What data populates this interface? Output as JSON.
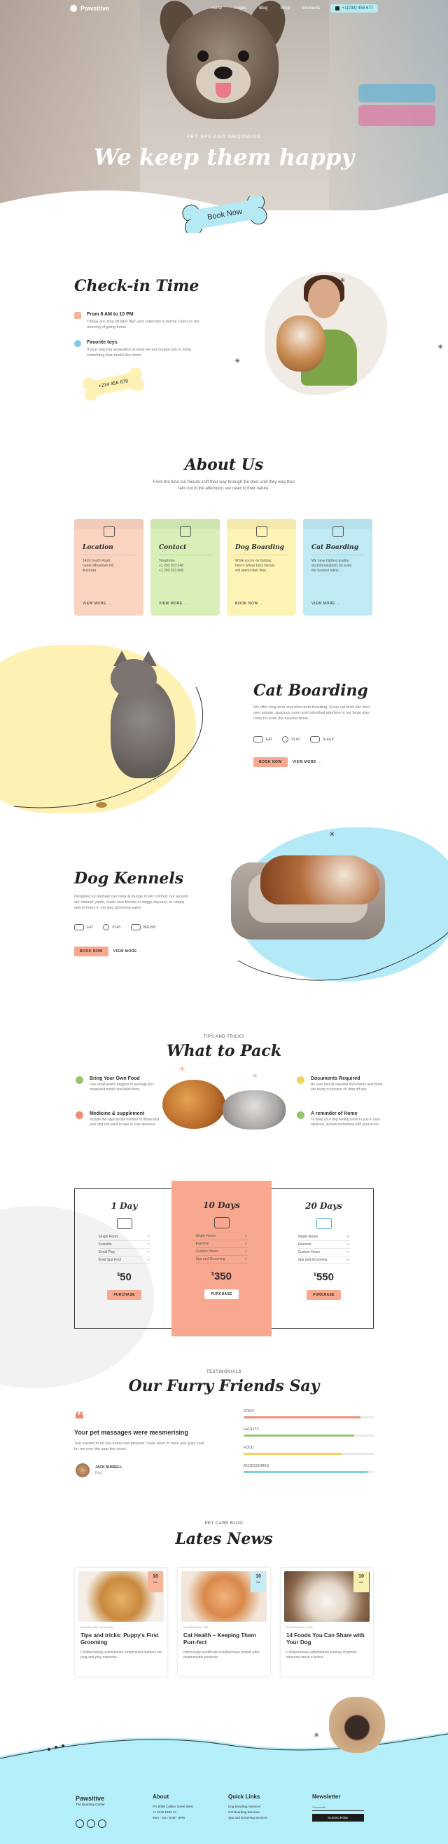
{
  "nav": {
    "brand": "Pawsitive",
    "links": [
      "Home",
      "Pages",
      "Blog",
      "Shop",
      "Elements"
    ],
    "phone": "+1(234) 456 677"
  },
  "hero": {
    "kicker": "PET SPA AND GROOMING",
    "title": "We keep them happy",
    "cta": "Book Now"
  },
  "checkin": {
    "title": "Check-in Time",
    "items": [
      {
        "head": "From 8 AM to 10 PM",
        "text": "Things are drop off after 8am and collection is before 10am on the morning of going home"
      },
      {
        "head": "Favorite toys",
        "text": "If your dog has separation anxiety we encourage you to bring something that smells like home"
      }
    ],
    "phone": "+234 456 678"
  },
  "about": {
    "title": "About Us",
    "subtitle": "From the time our friends sniff their way through the door until they wag their tails out in the afternoon, we cater to their nature.",
    "cards": [
      {
        "head": "Location",
        "lines": [
          "1426 South Road,",
          "Green Meadows NC",
          "Australia"
        ],
        "more": "VIEW MORE →",
        "color": "#fbd3c1"
      },
      {
        "head": "Contact",
        "lines": [
          "Telephone",
          "+1 203 013 548",
          "+1 203 013 608"
        ],
        "more": "VIEW MORE →",
        "color": "#d8efb8"
      },
      {
        "head": "Dog Boarding",
        "lines": [
          "While you're on holiday,",
          "here's where furry friends",
          "will spend their time."
        ],
        "more": "BOOK NOW →",
        "color": "#fdf3b5"
      },
      {
        "head": "Cat Boarding",
        "lines": [
          "We have highest quality",
          "accommodations for even",
          "the fussiest feline."
        ],
        "more": "VIEW MORE →",
        "color": "#bfeaf4"
      }
    ]
  },
  "cat": {
    "title": "Cat Boarding",
    "text": "We offer long-term and short term boarding. Every cat feels like their own private, spacious room and individual attention in our large play room for even the fussiest feline.",
    "feats": [
      "EAT",
      "PLAY",
      "SLEEP"
    ],
    "book": "BOOK NOW",
    "more": "VIEW MORE →"
  },
  "kennels": {
    "title": "Dog Kennels",
    "text": "Designed so animals can relax & lounge in pet comfort, our around our exterior yards, make new friends in doggy daycare, or simply spend hours in our dog grooming salon.",
    "feats": [
      "EAT",
      "PLAY",
      "BRUSH"
    ],
    "book": "BOOK NOW",
    "more": "VIEW MORE →"
  },
  "pack": {
    "kicker": "TIPS AND TRICKS",
    "title": "What to Pack",
    "items": [
      {
        "head": "Bring Your Own Food",
        "text": "Use small plastic baggies to package pre-measured meals and label them.",
        "color": "#93c66e"
      },
      {
        "head": "Medicine & supplement",
        "text": "Include the appropriate number of doses that your dog will need to take in your absence.",
        "color": "#f08b74"
      },
      {
        "head": "Documents Required",
        "text": "Be sure that all required documents and forms are ready to present on drop off day.",
        "color": "#f3d35a"
      },
      {
        "head": "A reminder of Home",
        "text": "To keep your dog feeling close to you in your absence, include something with your scent.",
        "color": "#93c66e"
      }
    ]
  },
  "pricing": {
    "plans": [
      {
        "title": "1 Day",
        "rows": [
          "Single Room",
          "Sociable",
          "Small Play",
          "Bowl Spa Pool"
        ],
        "price": "50",
        "btn": "PURCHASE"
      },
      {
        "title": "10 Days",
        "rows": [
          "Single Room",
          "Exercise",
          "Custom Hours",
          "Spa and Grooming"
        ],
        "price": "350",
        "btn": "PURCHASE"
      },
      {
        "title": "20 Days",
        "rows": [
          "Single Room",
          "Exercise",
          "Custom Hours",
          "Spa and Grooming"
        ],
        "price": "550",
        "btn": "PURCHASE"
      }
    ],
    "currency": "$"
  },
  "testimonials": {
    "kicker": "TESTIMONIALS",
    "title": "Our Furry Friends Say",
    "quote_head": "Your pet massages were mesmerising",
    "quote_text": "Just wanted to let you know how pleased I have been to have you guys care for me over the past few years.",
    "name": "JACK RUSSELL",
    "role": "Dog",
    "bars": [
      {
        "label": "STAFF",
        "value": 0.9,
        "color": "#f08b74"
      },
      {
        "label": "FACILITY",
        "value": 0.85,
        "color": "#93c66e"
      },
      {
        "label": "FOOD",
        "value": 0.75,
        "color": "#f3d35a"
      },
      {
        "label": "ACCESSORIES",
        "value": 0.95,
        "color": "#7fcde3"
      }
    ]
  },
  "news": {
    "kicker": "PET CARE BLOG",
    "title": "Lates News",
    "posts": [
      {
        "day": "10",
        "month": "JUL",
        "meta": "by AxiThemes  |  Grooming",
        "title": "Tips and tricks: Puppy's First Grooming",
        "text": "Collaboratively administrate empowered markets via plug-and-play networks...",
        "color": "#f6b59a"
      },
      {
        "day": "10",
        "month": "JUL",
        "meta": "by AxiThemes  |  Tips",
        "title": "Cat Health – Keeping Them Purr-fect",
        "text": "Intrinsically pontificate installed base portals after maintainable products...",
        "color": "#c6ecf6"
      },
      {
        "day": "10",
        "month": "JUL",
        "meta": "by AxiThemes  |  Food",
        "title": "14 Foods You Can Share with Your Dog",
        "text": "Collaboratively administrate turnkey channels whereas virtual e-tailers...",
        "color": "#f8f0b0"
      }
    ]
  },
  "footer": {
    "brand": "Pawsitive",
    "tagline": "The Boarding Center",
    "about_head": "About",
    "about_lines": [
      "PO 8008 Caliber Street West",
      "+1 2345 5482 47",
      "Mon - Sun: 8AM - 8PM"
    ],
    "links_head": "Quick Links",
    "links": [
      "Dog Boarding Services",
      "Cat Boarding Services",
      "Spa and Grooming Services"
    ],
    "newsletter_head": "Newsletter",
    "email_placeholder": "Your email",
    "subscribe": "SUBSCRIBE"
  },
  "colors": {
    "accent": "#f7a88e",
    "hero_button": "#b5eaf5",
    "footer_bg": "#b4eef9"
  }
}
